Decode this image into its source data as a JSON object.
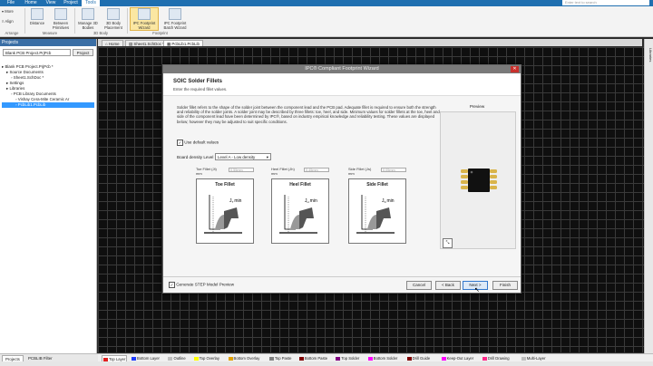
{
  "ribbon": {
    "tabs": [
      "File",
      "Home",
      "View",
      "Project",
      "Tools"
    ],
    "active_tab": "Tools",
    "search_placeholder": "Enter text to search",
    "buttons": {
      "more": "More",
      "align": "Align",
      "distance": "Distance",
      "between_primitives": "Between Primitives",
      "manage_3d": "Manage 3D Bodies",
      "body_placement": "3D Body Placement",
      "ipc_wizard": "IPC Footprint Wizard",
      "ipc_batch": "IPC Footprint Batch Wizard"
    },
    "groups": {
      "arrange": "Arrange",
      "measure": "Measure",
      "body3d": "3D Body",
      "footprint": "Footprint"
    }
  },
  "projects": {
    "title": "Projects",
    "workspace": "Blank PCB Project.PrjPcb",
    "project_button": "Project",
    "tree": [
      {
        "label": "Blank PCB Project.PrjPcb *",
        "indent": 0,
        "selected": false
      },
      {
        "label": "Source Documents",
        "indent": 1,
        "selected": false
      },
      {
        "label": "Sheet1.SchDoc *",
        "indent": 2,
        "selected": false
      },
      {
        "label": "Settings",
        "indent": 1,
        "selected": false
      },
      {
        "label": "Libraries",
        "indent": 1,
        "selected": false
      },
      {
        "label": "PCB Library Documents",
        "indent": 2,
        "selected": false
      },
      {
        "label": "Vishay Cera-Mite Ceramic Ar",
        "indent": 3,
        "selected": false
      },
      {
        "label": "PcbLib1.PcbLib",
        "indent": 3,
        "selected": true
      }
    ]
  },
  "doc_tabs": [
    "Home",
    "Sheet1.SchDoc *",
    "PcbLib1.PcbLib"
  ],
  "active_doc": "PcbLib1.PcbLib",
  "right_strip_label": "Libraries",
  "dialog": {
    "title": "IPC® Compliant Footprint Wizard",
    "heading": "SOIC Solder Fillets",
    "subheading": "Enter the required fillet values.",
    "description": "Solder fillet refers to the shape of the solder joint between the component lead and the PCB pad. Adequate fillet is required to ensure both the strength and reliability of the solder joints. A solder joint may be described by three fillets: toe, heel, and side. Minimum values for solder fillets at the toe, heel and side of the component lead have been determined by IPC®, based on industry empirical knowledge and reliability testing. These values are displayed below; however they may be adjusted to suit specific conditions.",
    "use_default_label": "Use default values",
    "use_default_checked": true,
    "board_density_label": "Board density Level",
    "board_density_value": "Level A - Low density",
    "fillets": [
      {
        "label": "Toe Fillet (Jt)",
        "unit": "mm",
        "value": "0.55mm",
        "title": "Toe Fillet",
        "dim": "J",
        "sub": "T",
        "suffix": "min"
      },
      {
        "label": "Heel Fillet (Jh)",
        "unit": "mm",
        "value": "0.45mm",
        "title": "Heel Fillet",
        "dim": "J",
        "sub": "H",
        "suffix": "min"
      },
      {
        "label": "Side Fillet (Js)",
        "unit": "mm",
        "value": "0.05mm",
        "title": "Side Fillet",
        "dim": "J",
        "sub": "S",
        "suffix": "min"
      }
    ],
    "preview_label": "Preview",
    "step_label": "Generate STEP Model Preview",
    "step_checked": true,
    "buttons": {
      "cancel": "Cancel",
      "back": "< Back",
      "next": "Next >",
      "finish": "Finish"
    }
  },
  "bottom_tabs": [
    "Projects",
    "PCBLIB Filter"
  ],
  "layers": [
    {
      "name": "Top Layer",
      "color": "#e02020",
      "active": true
    },
    {
      "name": "Bottom Layer",
      "color": "#1e3cff",
      "active": false
    },
    {
      "name": "Outline",
      "color": "#c0c0c0",
      "active": false
    },
    {
      "name": "Top Overlay",
      "color": "#ffff00",
      "active": false
    },
    {
      "name": "Bottom Overlay",
      "color": "#e0a000",
      "active": false
    },
    {
      "name": "Top Paste",
      "color": "#808080",
      "active": false
    },
    {
      "name": "Bottom Paste",
      "color": "#800000",
      "active": false
    },
    {
      "name": "Top Solder",
      "color": "#800080",
      "active": false
    },
    {
      "name": "Bottom Solder",
      "color": "#ff00ff",
      "active": false
    },
    {
      "name": "Drill Guide",
      "color": "#800000",
      "active": false
    },
    {
      "name": "Keep-Out Layer",
      "color": "#ff00ff",
      "active": false
    },
    {
      "name": "Drill Drawing",
      "color": "#ff2a8a",
      "active": false
    },
    {
      "name": "Multi-Layer",
      "color": "#c0c0c0",
      "active": false
    }
  ],
  "colors": {
    "accent": "#1f6fb0",
    "canvas": "#0f0f0f",
    "grid": "#3a3a3a"
  }
}
